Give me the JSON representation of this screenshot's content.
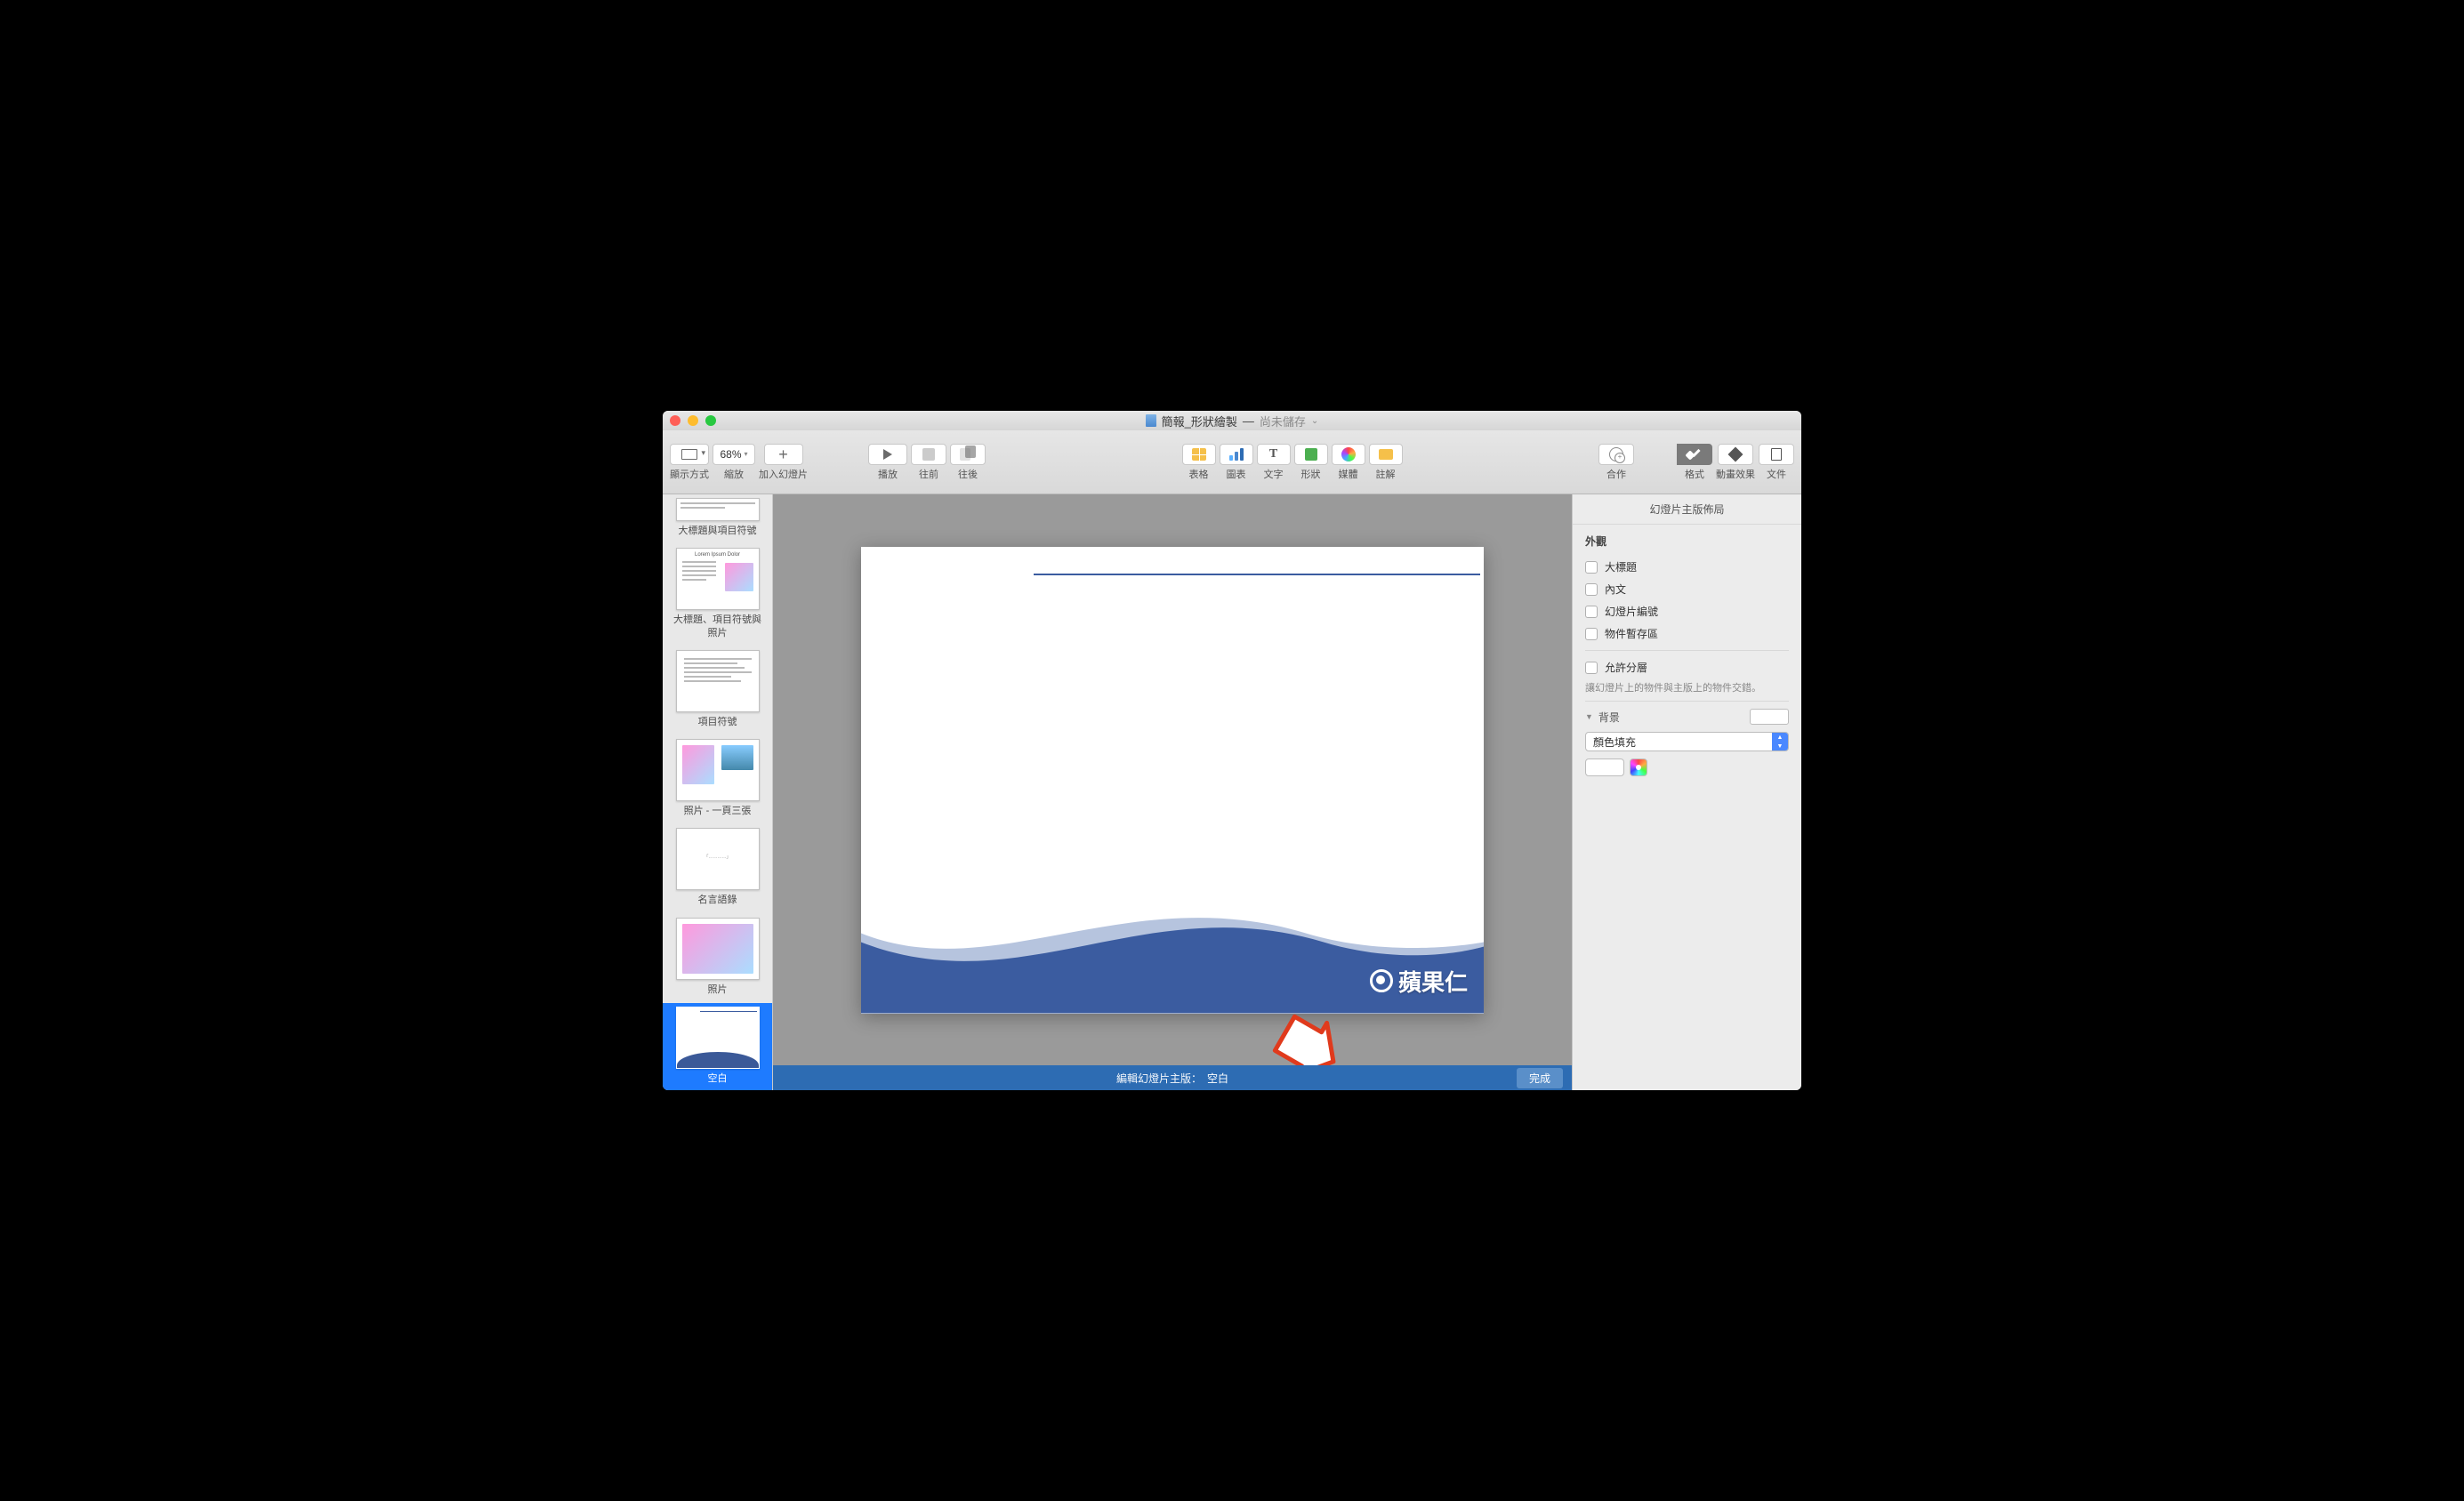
{
  "titlebar": {
    "doc_title": "簡報_形狀繪製",
    "dash": "—",
    "status": "尚未儲存"
  },
  "toolbar": {
    "view": "顯示方式",
    "zoom_value": "68%",
    "zoom_label": "縮放",
    "add_slide": "加入幻燈片",
    "play": "播放",
    "prev": "往前",
    "next": "往後",
    "table": "表格",
    "chart": "圖表",
    "text": "文字",
    "shape": "形狀",
    "media": "媒體",
    "comment": "註解",
    "collab": "合作",
    "format": "格式",
    "animate": "動畫效果",
    "document": "文件"
  },
  "sidebar": {
    "items": [
      {
        "label": "大標題與項目符號"
      },
      {
        "label": "大標題、項目符號與照片"
      },
      {
        "label": "項目符號"
      },
      {
        "label": "照片 - 一頁三張"
      },
      {
        "label": "名言語錄"
      },
      {
        "label": "照片"
      },
      {
        "label": "空白"
      }
    ],
    "mini_title": "Lorem Ipsum Dolor"
  },
  "slide": {
    "logo_text": "蘋果仁"
  },
  "editbar": {
    "label": "編輯幻燈片主版：",
    "value": "空白",
    "done": "完成"
  },
  "inspector": {
    "title": "幻燈片主版佈局",
    "appearance": "外觀",
    "checks": {
      "title": "大標題",
      "body": "內文",
      "slide_number": "幻燈片編號",
      "placeholder": "物件暫存區"
    },
    "allow_layer": "允許分層",
    "allow_layer_sub": "讓幻燈片上的物件與主版上的物件交錯。",
    "background": "背景",
    "fill_type": "顏色填充"
  }
}
